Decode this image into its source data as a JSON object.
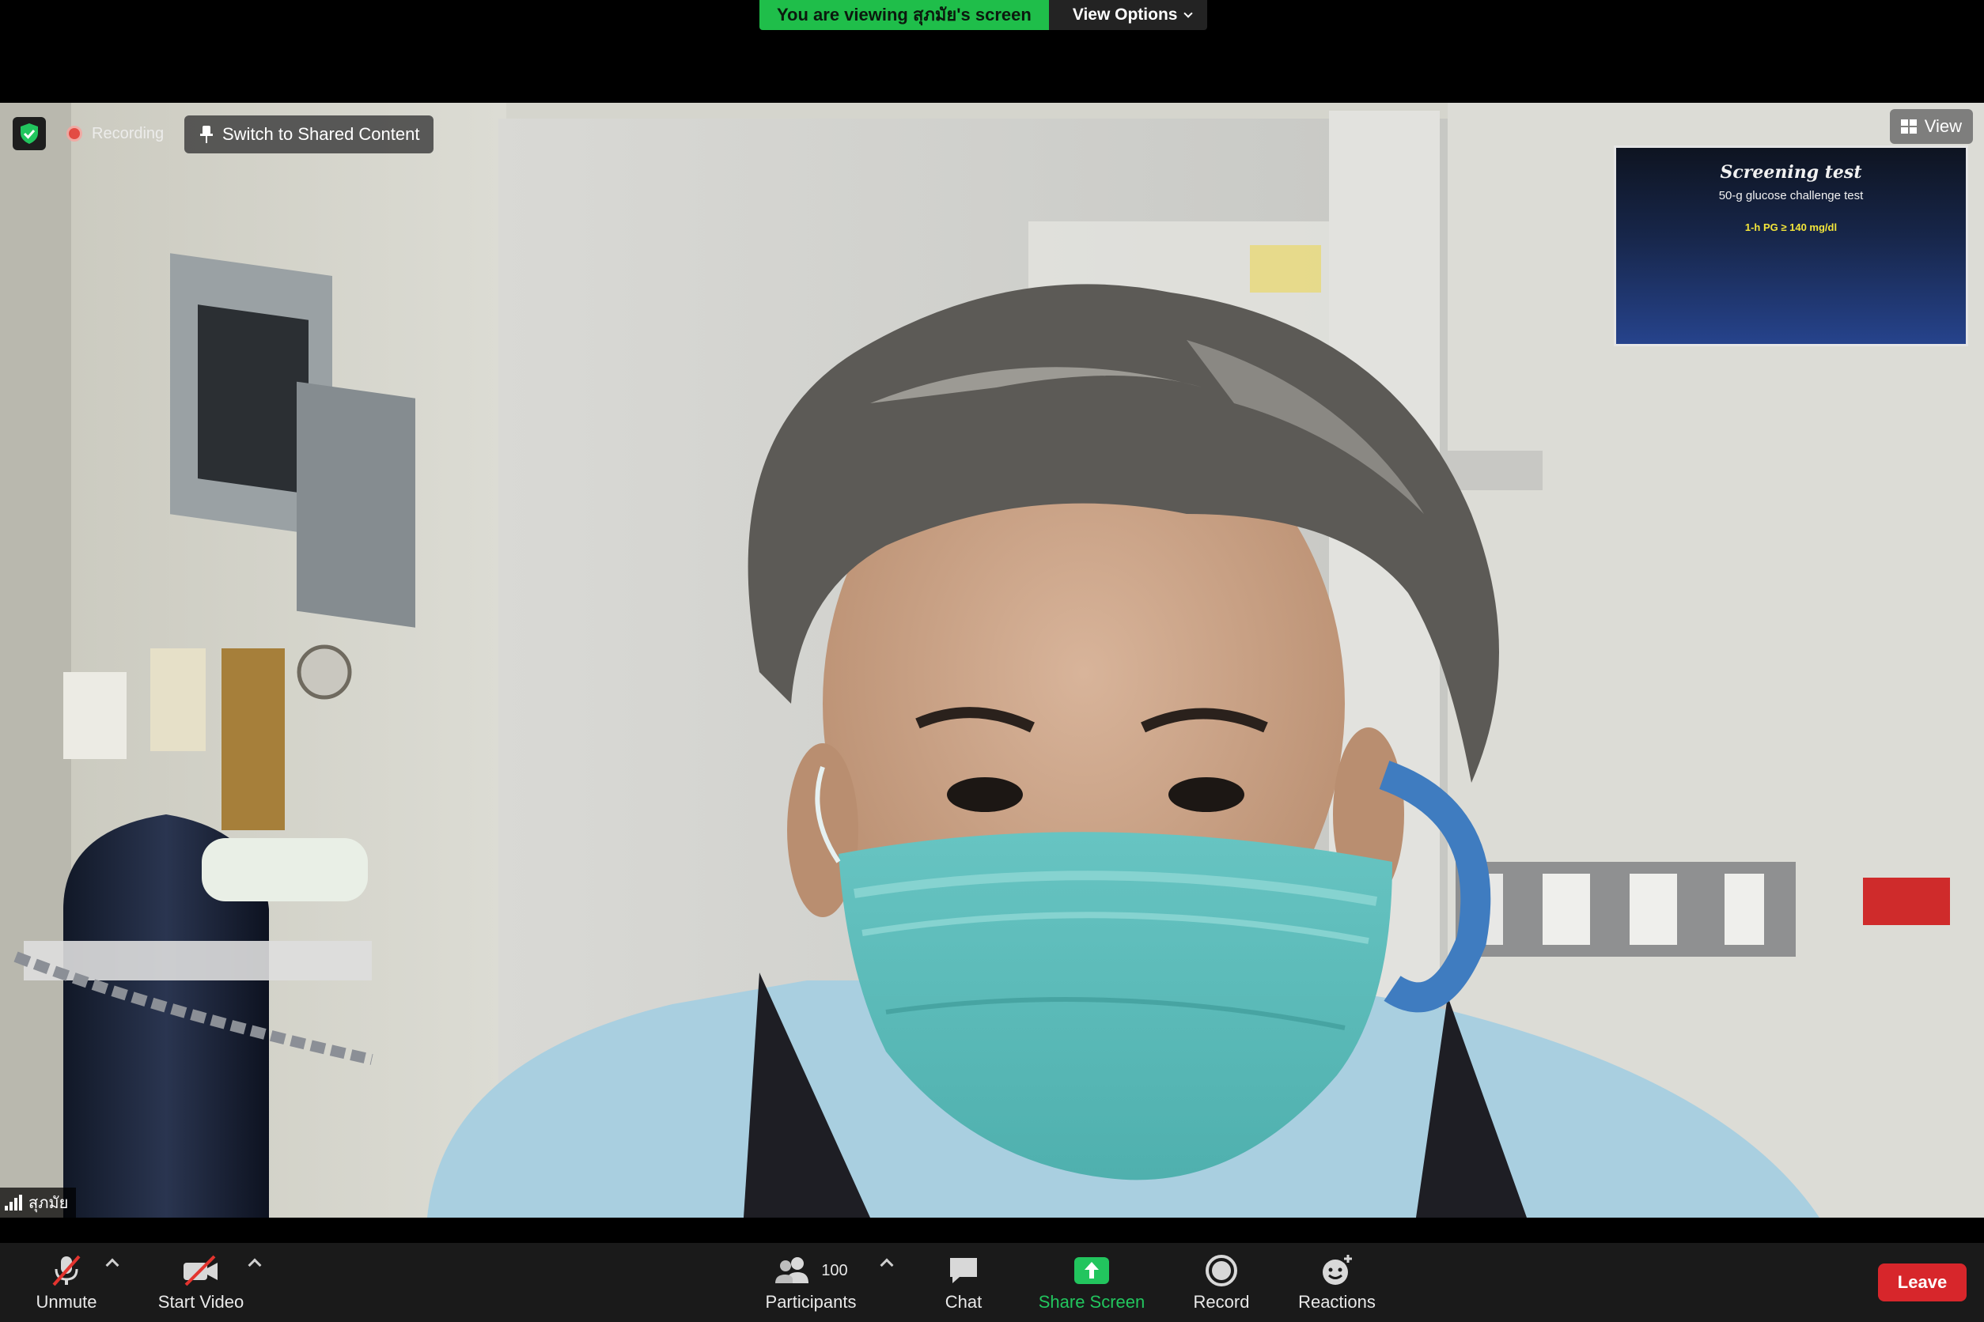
{
  "top_bar": {
    "viewing_status": "You are viewing สุภมัย's screen",
    "view_options_label": "View Options"
  },
  "video": {
    "recording_label": "Recording",
    "switch_button_label": "Switch to Shared Content",
    "view_button_label": "View",
    "participant_name": "สุภมัย"
  },
  "shared_thumbnail": {
    "title": "Screening test",
    "subtitle": "50-g glucose challenge test",
    "value": "1-h PG ≥ 140 mg/dl"
  },
  "toolbar": {
    "unmute_label": "Unmute",
    "start_video_label": "Start Video",
    "participants_label": "Participants",
    "participants_count": "100",
    "chat_label": "Chat",
    "share_screen_label": "Share Screen",
    "record_label": "Record",
    "reactions_label": "Reactions",
    "leave_label": "Leave"
  },
  "colors": {
    "status_green": "#1fbe4a",
    "share_green": "#22c55e",
    "leave_red": "#d7262b",
    "recording_red": "#e8372f"
  }
}
